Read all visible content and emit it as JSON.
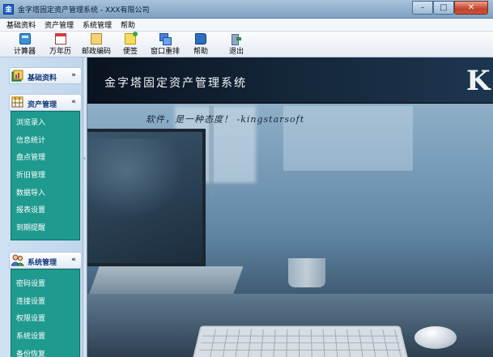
{
  "window": {
    "title": "金字塔固定资产管理系统 - XXX有限公司",
    "controls": {
      "minimize": "–",
      "maximize": "□",
      "close": "✕"
    }
  },
  "menubar": [
    "基础资料",
    "资产管理",
    "系统管理",
    "帮助"
  ],
  "toolbar": [
    {
      "label": "计算器",
      "icon": "calculator-icon"
    },
    {
      "label": "万年历",
      "icon": "calendar-icon"
    },
    {
      "label": "邮政编码",
      "icon": "postcode-icon"
    },
    {
      "label": "便签",
      "icon": "note-icon"
    },
    {
      "label": "窗口重排",
      "icon": "windows-arrange-icon"
    },
    {
      "label": "帮助",
      "icon": "help-book-icon"
    },
    {
      "label": "退出",
      "icon": "exit-door-icon"
    }
  ],
  "sidebar": {
    "groups": [
      {
        "title": "基础资料",
        "chevron": "»",
        "expanded": false,
        "items": []
      },
      {
        "title": "资产管理",
        "chevron": "«",
        "expanded": true,
        "items": [
          "浏览录入",
          "信息统计",
          "盘点管理",
          "折旧管理",
          "数据导入",
          "报表设置",
          "到期提醒"
        ]
      },
      {
        "title": "系统管理",
        "chevron": "«",
        "expanded": true,
        "items": [
          "密码设置",
          "连接设置",
          "权限设置",
          "系统设置",
          "备份恢复"
        ]
      }
    ]
  },
  "main": {
    "banner_title": "金字塔固定资产管理系统",
    "banner_logo": "K",
    "slogan": "软件，是一种态度！ -kingstarsoft"
  },
  "colors": {
    "titlebar": "#8fb0cf",
    "sidebar_list": "#1f9a8f",
    "sidebar_title": "#16397a",
    "banner": "#0d1826"
  }
}
